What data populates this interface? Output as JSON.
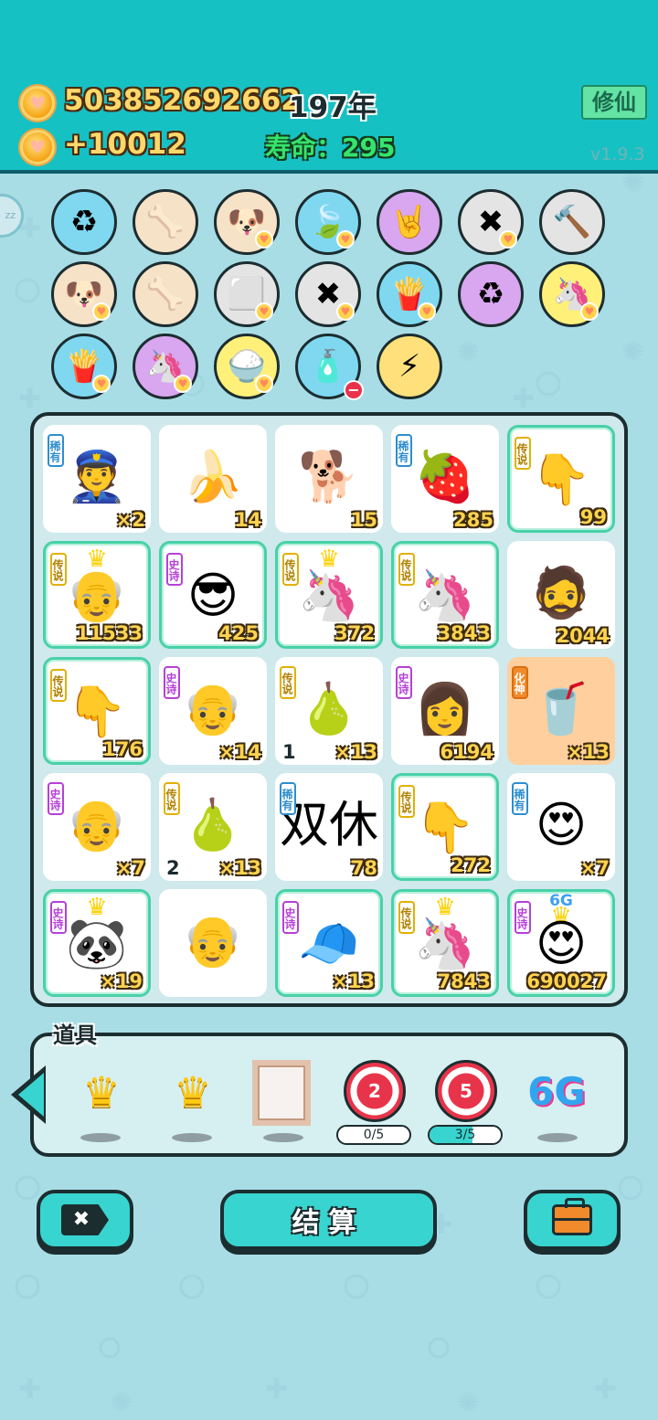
{
  "header": {
    "coins": "503852692662",
    "year": "197年",
    "income": "+10012",
    "life": "寿命：295",
    "xiuxian_label": "修仙",
    "version": "v1.9.3",
    "side_badge": "zz"
  },
  "inventory_items": [
    {
      "icon": "♻",
      "name": "trash-bag-icon",
      "bg": "#7fd8f0",
      "heart": false,
      "minus": false
    },
    {
      "icon": "🦴",
      "name": "pet-bowl-icon",
      "bg": "#f6e2c7",
      "heart": false,
      "minus": false
    },
    {
      "icon": "🐶",
      "name": "dog-glasses-icon",
      "bg": "#f6e2c7",
      "heart": true,
      "minus": false
    },
    {
      "icon": "🍃",
      "name": "leaf-icon",
      "bg": "#7fd8f0",
      "heart": true,
      "minus": false
    },
    {
      "icon": "🤘",
      "name": "rock-hand-icon",
      "bg": "#d9a6f0",
      "heart": false,
      "minus": false
    },
    {
      "icon": "✖",
      "name": "remove-tag-icon",
      "bg": "#e4e4e4",
      "heart": true,
      "minus": false
    },
    {
      "icon": "🔨",
      "name": "hammer-icon",
      "bg": "#e4e4e4",
      "heart": false,
      "minus": false
    },
    {
      "icon": "🐶",
      "name": "dog-glasses-icon",
      "bg": "#f6e2c7",
      "heart": true,
      "minus": false
    },
    {
      "icon": "🦴",
      "name": "pet-bowl-icon",
      "bg": "#f6e2c7",
      "heart": false,
      "minus": false
    },
    {
      "icon": "⬜",
      "name": "sugar-cubes-icon",
      "bg": "#e4e4e4",
      "heart": true,
      "minus": false
    },
    {
      "icon": "✖",
      "name": "remove-tag-icon",
      "bg": "#e4e4e4",
      "heart": true,
      "minus": false
    },
    {
      "icon": "🍟",
      "name": "fries-icon",
      "bg": "#7fd8f0",
      "heart": true,
      "minus": false
    },
    {
      "icon": "♻",
      "name": "recycle-icon",
      "bg": "#d9a6f0",
      "heart": false,
      "minus": false
    },
    {
      "icon": "🦄",
      "name": "unicorn-icon",
      "bg": "#fff07a",
      "heart": true,
      "minus": false
    },
    {
      "icon": "🍟",
      "name": "fries-icon",
      "bg": "#7fd8f0",
      "heart": true,
      "minus": false
    },
    {
      "icon": "🦄",
      "name": "unicorn-pair-icon",
      "bg": "#d9a6f0",
      "heart": true,
      "minus": false
    },
    {
      "icon": "🍚",
      "name": "rice-bowl-icon",
      "bg": "#fff07a",
      "heart": true,
      "minus": false
    },
    {
      "icon": "🧴",
      "name": "bag-icon",
      "bg": "#7fd8f0",
      "heart": false,
      "minus": true
    },
    {
      "icon": "⚡",
      "name": "lightning-icon",
      "bg": "#ffe07a",
      "heart": false,
      "minus": false
    }
  ],
  "grid": [
    {
      "tag": "稀有",
      "tagType": "rare",
      "glyph": "👮",
      "name": "police-face",
      "count": "×2",
      "left": "",
      "glow": false,
      "orange": false,
      "crown": false,
      "sixg": false
    },
    {
      "tag": "",
      "tagType": "",
      "glyph": "🍌",
      "name": "banana",
      "count": "14",
      "left": "",
      "glow": false,
      "orange": false,
      "crown": false,
      "sixg": false
    },
    {
      "tag": "",
      "tagType": "",
      "glyph": "🐕",
      "name": "dog",
      "count": "15",
      "left": "",
      "glow": false,
      "orange": false,
      "crown": false,
      "sixg": false
    },
    {
      "tag": "稀有",
      "tagType": "rare",
      "glyph": "🍓",
      "name": "lychee",
      "count": "285",
      "left": "",
      "glow": false,
      "orange": false,
      "crown": false,
      "sixg": false
    },
    {
      "tag": "传说",
      "tagType": "leg",
      "glyph": "👇",
      "name": "pointing-hand",
      "count": "99",
      "left": "",
      "glow": true,
      "orange": false,
      "crown": false,
      "sixg": false
    },
    {
      "tag": "传说",
      "tagType": "leg",
      "glyph": "👴",
      "name": "crowned-old-man",
      "count": "11533",
      "left": "",
      "glow": true,
      "orange": false,
      "crown": true,
      "sixg": false
    },
    {
      "tag": "史诗",
      "tagType": "epic",
      "glyph": "😎",
      "name": "green-hat-man",
      "count": "425",
      "left": "",
      "glow": true,
      "orange": false,
      "crown": false,
      "sixg": false
    },
    {
      "tag": "传说",
      "tagType": "leg",
      "glyph": "🦄",
      "name": "crowned-unicorn",
      "count": "372",
      "left": "",
      "glow": true,
      "orange": false,
      "crown": true,
      "sixg": false
    },
    {
      "tag": "传说",
      "tagType": "leg",
      "glyph": "🦄",
      "name": "unicorn",
      "count": "3843",
      "left": "",
      "glow": true,
      "orange": false,
      "crown": false,
      "sixg": false
    },
    {
      "tag": "",
      "tagType": "",
      "glyph": "🧔",
      "name": "stubble-man",
      "count": "2044",
      "left": "",
      "glow": false,
      "orange": false,
      "crown": false,
      "sixg": false
    },
    {
      "tag": "传说",
      "tagType": "leg",
      "glyph": "👇",
      "name": "pointing-hand",
      "count": "176",
      "left": "",
      "glow": true,
      "orange": false,
      "crown": false,
      "sixg": false
    },
    {
      "tag": "史诗",
      "tagType": "epic",
      "glyph": "👴",
      "name": "glasses-old-man",
      "count": "×14",
      "left": "",
      "glow": false,
      "orange": false,
      "crown": false,
      "sixg": false
    },
    {
      "tag": "传说",
      "tagType": "leg",
      "glyph": "🍐",
      "name": "pomelo",
      "count": "×13",
      "left": "1",
      "glow": false,
      "orange": false,
      "crown": false,
      "sixg": false
    },
    {
      "tag": "史诗",
      "tagType": "epic",
      "glyph": "👩",
      "name": "braided-girl",
      "count": "6194",
      "left": "",
      "glow": false,
      "orange": false,
      "crown": false,
      "sixg": false
    },
    {
      "tag": "化神",
      "tagType": "god",
      "glyph": "🥤",
      "name": "milk-tea",
      "count": "×13",
      "left": "",
      "glow": false,
      "orange": true,
      "crown": false,
      "sixg": false
    },
    {
      "tag": "史诗",
      "tagType": "epic",
      "glyph": "👴",
      "name": "glasses-old-man",
      "count": "×7",
      "left": "",
      "glow": false,
      "orange": false,
      "crown": false,
      "sixg": false
    },
    {
      "tag": "传说",
      "tagType": "leg",
      "glyph": "🍐",
      "name": "pomelo",
      "count": "×13",
      "left": "2",
      "glow": false,
      "orange": false,
      "crown": false,
      "sixg": false
    },
    {
      "tag": "稀有",
      "tagType": "rare",
      "glyph": "双休",
      "name": "double-rest",
      "count": "78",
      "left": "",
      "glow": false,
      "orange": false,
      "crown": false,
      "sixg": false
    },
    {
      "tag": "传说",
      "tagType": "leg",
      "glyph": "👇",
      "name": "pointing-hand",
      "count": "272",
      "left": "",
      "glow": true,
      "orange": false,
      "crown": false,
      "sixg": false
    },
    {
      "tag": "稀有",
      "tagType": "rare",
      "glyph": "😍",
      "name": "heart-eyes-man",
      "count": "×7",
      "left": "",
      "glow": false,
      "orange": false,
      "crown": false,
      "sixg": false
    },
    {
      "tag": "史诗",
      "tagType": "epic",
      "glyph": "🐼",
      "name": "crowned-panda",
      "count": "×19",
      "left": "",
      "glow": true,
      "orange": false,
      "crown": true,
      "sixg": false
    },
    {
      "tag": "",
      "tagType": "",
      "glyph": "👴",
      "name": "glasses-grandpa",
      "count": "",
      "left": "",
      "glow": false,
      "orange": false,
      "crown": false,
      "sixg": false
    },
    {
      "tag": "史诗",
      "tagType": "epic",
      "glyph": "🧢",
      "name": "red-cap-boy",
      "count": "×13",
      "left": "",
      "glow": true,
      "orange": false,
      "crown": false,
      "sixg": false
    },
    {
      "tag": "传说",
      "tagType": "leg",
      "glyph": "🦄",
      "name": "crowned-unicorn",
      "count": "7843",
      "left": "",
      "glow": true,
      "orange": false,
      "crown": true,
      "sixg": false
    },
    {
      "tag": "史诗",
      "tagType": "epic",
      "glyph": "😍",
      "name": "crowned-heart-eyes-man",
      "count": "690027",
      "left": "",
      "glow": true,
      "orange": false,
      "crown": true,
      "sixg": true
    }
  ],
  "tools": {
    "label": "道具",
    "items": [
      {
        "name": "crown-tool",
        "type": "crown"
      },
      {
        "name": "crown-tool",
        "type": "crown"
      },
      {
        "name": "frame-tool",
        "type": "frame"
      },
      {
        "name": "target-tool-2",
        "type": "target",
        "num": "2",
        "progress": "0/5",
        "fill": 0
      },
      {
        "name": "target-tool-5",
        "type": "target",
        "num": "5",
        "progress": "3/5",
        "fill": 0.6
      },
      {
        "name": "6g-tool",
        "type": "sixg",
        "text": "6G"
      }
    ]
  },
  "grid_glyph_labels": {
    "sixg": "6G"
  },
  "buttons": {
    "settle": "结算"
  }
}
